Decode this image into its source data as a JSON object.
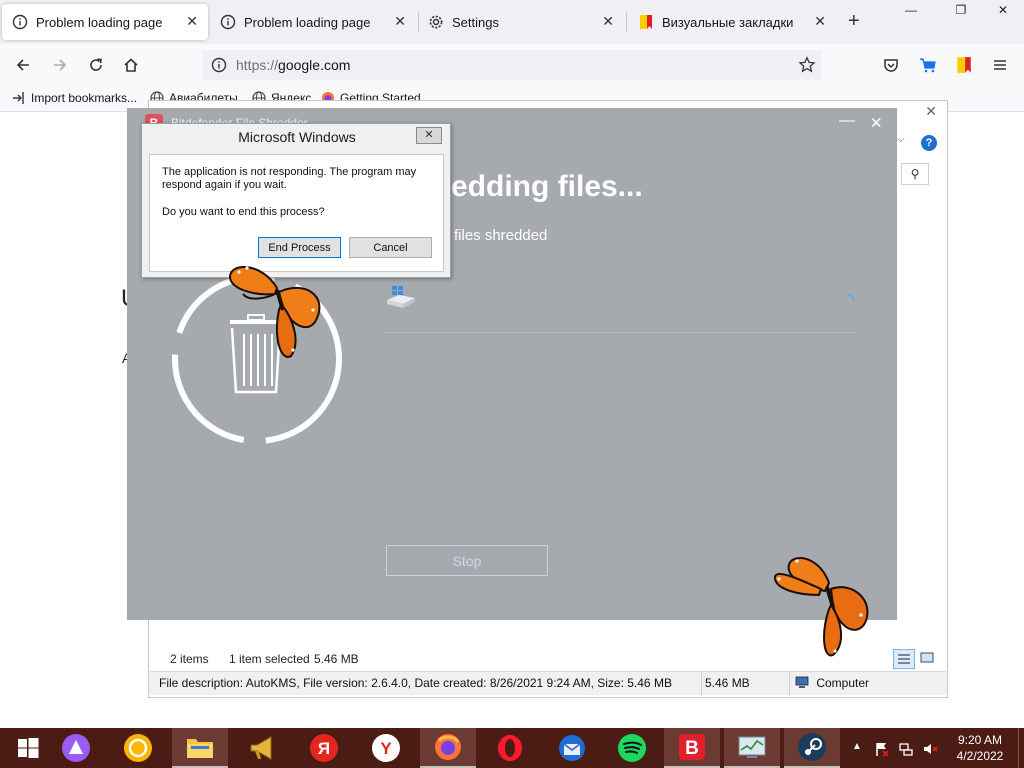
{
  "browser": {
    "tabs": [
      {
        "title": "Problem loading page",
        "icon": "info-icon",
        "active": true
      },
      {
        "title": "Problem loading page",
        "icon": "info-icon",
        "active": false
      },
      {
        "title": "Settings",
        "icon": "gear-icon",
        "active": false
      },
      {
        "title": "Визуальные закладки",
        "icon": "yandex-bookmarks-icon",
        "active": false
      }
    ],
    "url_scheme": "https://",
    "url_host": "google.com",
    "bookmarks": [
      {
        "label": "Import bookmarks...",
        "icon": "import-icon"
      },
      {
        "label": "Авиабилеты",
        "icon": "globe-icon"
      },
      {
        "label": "Яндекс",
        "icon": "globe-icon"
      },
      {
        "label": "Getting Started",
        "icon": "firefox-icon"
      }
    ]
  },
  "explorer": {
    "items_count": "2 items",
    "selected": "1 item selected",
    "selected_size": "5.46 MB",
    "file_description": "File description: AutoKMS, File version: 2.6.4.0, Date created: 8/26/2021 9:24 AM, Size: 5.46 MB",
    "size": "5.46 MB",
    "location": "Computer"
  },
  "shredder": {
    "title": "Bitdefender File Shredder",
    "heading": "edding files...",
    "subtext": "files shredded",
    "stop_label": "Stop"
  },
  "dialog": {
    "title": "Microsoft Windows",
    "message": "The application is not responding. The program may respond again if you wait.",
    "question": "Do you want to end this process?",
    "end_process_label": "End Process",
    "cancel_label": "Cancel"
  },
  "taskbar": {
    "time": "9:20 AM",
    "date": "4/2/2022",
    "apps": [
      "start",
      "alice",
      "yandex-disk",
      "file-explorer",
      "loudspeaker",
      "yandex",
      "yandex-browser",
      "firefox",
      "opera",
      "thunderbird",
      "spotify",
      "bitdefender",
      "task-manager",
      "steam"
    ]
  },
  "colors": {
    "taskbar": "#4a1c14",
    "shredder_overlay": "#a6aaaf",
    "tab_bar": "#f0f0f4",
    "accent_blue": "#0078d7"
  }
}
